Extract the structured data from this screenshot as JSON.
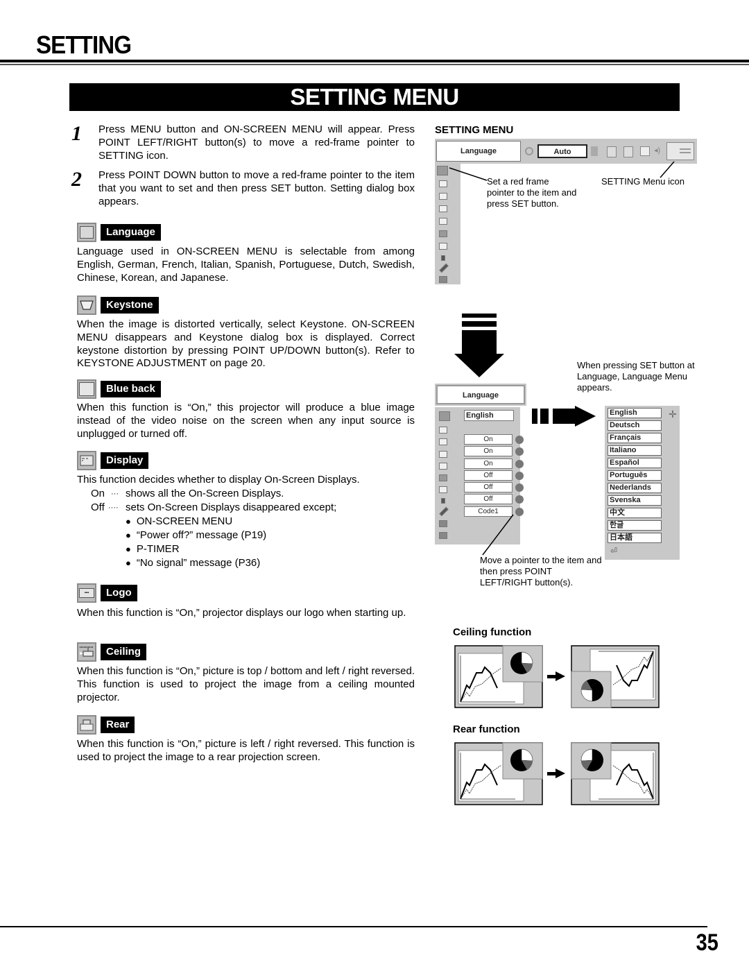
{
  "page": {
    "title": "SETTING",
    "banner": "SETTING MENU",
    "page_number": "35"
  },
  "steps": [
    {
      "num": "1",
      "text": "Press MENU button and ON-SCREEN MENU will appear.  Press POINT LEFT/RIGHT button(s) to move a red-frame pointer to SETTING icon."
    },
    {
      "num": "2",
      "text": "Press POINT DOWN button to move a red-frame pointer to the item that you want to set and then press SET button.  Setting dialog box appears."
    }
  ],
  "sections": {
    "language": {
      "icon": "language-icon",
      "label": "Language",
      "text": "Language used in ON-SCREEN MENU is selectable from among English, German, French, Italian, Spanish, Portuguese, Dutch, Swedish, Chinese, Korean, and Japanese."
    },
    "keystone": {
      "icon": "keystone-icon",
      "label": "Keystone",
      "text": "When the image is distorted vertically, select Keystone.  ON-SCREEN MENU disappears and Keystone dialog box is displayed. Correct keystone distortion by pressing POINT UP/DOWN button(s). Refer to KEYSTONE ADJUSTMENT on page 20."
    },
    "blueback": {
      "icon": "blue-back-icon",
      "label": "Blue back",
      "text": "When this function is “On,” this projector will produce a blue image instead of the video noise on the screen when any input source is unplugged or turned off."
    },
    "display": {
      "icon": "display-icon",
      "label": "Display",
      "text": "This function decides whether to display On-Screen Displays.",
      "on_key": "On",
      "on_dots": "···",
      "on_text": "shows all the On-Screen Displays.",
      "off_key": "Off",
      "off_dots": "····",
      "off_text": "sets On-Screen Displays disappeared except;",
      "bullets": [
        "ON-SCREEN MENU",
        "“Power off?” message (P19)",
        "P-TIMER",
        "“No signal” message (P36)"
      ]
    },
    "logo": {
      "icon": "logo-icon",
      "label": "Logo",
      "text": "When this function is “On,” projector displays our logo when starting up."
    },
    "ceiling": {
      "icon": "ceiling-icon",
      "label": "Ceiling",
      "text": "When this function is “On,” picture is top / bottom and left / right reversed.  This function is used to project the image from a ceiling mounted projector."
    },
    "rear": {
      "icon": "rear-icon",
      "label": "Rear",
      "text": "When this function is “On,” picture is left / right reversed.  This function is used to project the image to a rear projection screen."
    }
  },
  "diagram": {
    "title": "SETTING MENU",
    "menubar": {
      "item_label": "Language",
      "value": "Auto"
    },
    "callout_pointer": "Set a red frame pointer to the item and press SET button.",
    "callout_icon": "SETTING Menu icon",
    "callout_set": "When pressing SET button at Language, Language Menu appears.",
    "callout_move": "Move a pointer to the item and then press POINT LEFT/RIGHT button(s).",
    "setting_panel": {
      "header": "Language",
      "language_value": "English",
      "values": [
        "On",
        "On",
        "On",
        "Off",
        "Off",
        "Off",
        "Code1"
      ]
    },
    "language_menu": [
      "English",
      "Deutsch",
      "Français",
      "Italiano",
      "Español",
      "Português",
      "Nederlands",
      "Svenska",
      "中文",
      "한글",
      "日本語"
    ],
    "ceiling_title": "Ceiling function",
    "rear_title": "Rear function"
  }
}
